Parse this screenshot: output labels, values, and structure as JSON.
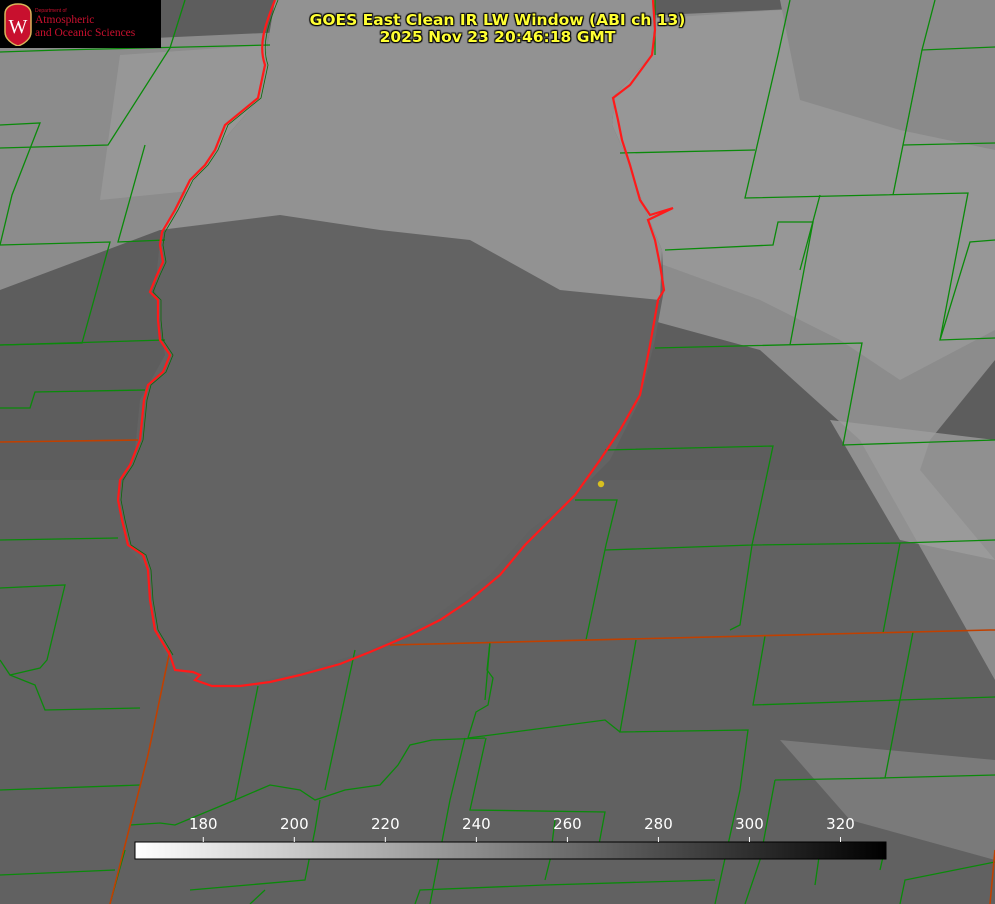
{
  "logo": {
    "department": "Department of",
    "line1": "Atmospheric",
    "line2": "and Oceanic Sciences",
    "seal_letter": "W"
  },
  "title": {
    "line1": "GOES East Clean IR LW Window (ABI ch 13)",
    "line2": "2025 Nov 23 20:46:18 GMT"
  },
  "colorbar": {
    "min": 165,
    "max": 330,
    "ticks": [
      180,
      200,
      220,
      240,
      260,
      280,
      300,
      320
    ],
    "gradient": [
      "#ffffff",
      "#000000"
    ]
  },
  "colors": {
    "title": "#ffff33",
    "county_lines": "#0a8a0a",
    "state_lines": "#c04000",
    "coastline": "#ff1a1a",
    "marker": "#d8c020"
  }
}
